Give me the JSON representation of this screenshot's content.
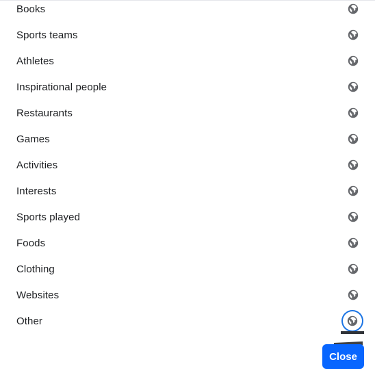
{
  "list": {
    "items": [
      {
        "label": "Books",
        "privacy_icon": "globe-icon",
        "privacy": "Public"
      },
      {
        "label": "Sports teams",
        "privacy_icon": "globe-icon",
        "privacy": "Public"
      },
      {
        "label": "Athletes",
        "privacy_icon": "globe-icon",
        "privacy": "Public"
      },
      {
        "label": "Inspirational people",
        "privacy_icon": "globe-icon",
        "privacy": "Public"
      },
      {
        "label": "Restaurants",
        "privacy_icon": "globe-icon",
        "privacy": "Public"
      },
      {
        "label": "Games",
        "privacy_icon": "globe-icon",
        "privacy": "Public"
      },
      {
        "label": "Activities",
        "privacy_icon": "globe-icon",
        "privacy": "Public"
      },
      {
        "label": "Interests",
        "privacy_icon": "globe-icon",
        "privacy": "Public"
      },
      {
        "label": "Sports played",
        "privacy_icon": "globe-icon",
        "privacy": "Public"
      },
      {
        "label": "Foods",
        "privacy_icon": "globe-icon",
        "privacy": "Public"
      },
      {
        "label": "Clothing",
        "privacy_icon": "globe-icon",
        "privacy": "Public"
      },
      {
        "label": "Websites",
        "privacy_icon": "globe-icon",
        "privacy": "Public"
      },
      {
        "label": "Other",
        "privacy_icon": "globe-icon",
        "privacy": "Public",
        "focused": true
      }
    ]
  },
  "footer": {
    "close_label": "Close"
  },
  "colors": {
    "accent": "#0866ff",
    "focus_ring": "#1b74e4",
    "text": "#1c1e21",
    "icon": "#65676b"
  }
}
